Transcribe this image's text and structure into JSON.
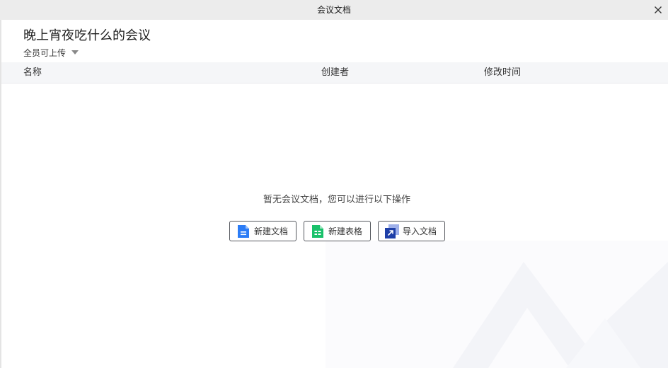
{
  "window": {
    "title": "会议文档",
    "close_icon": "close-icon"
  },
  "meeting": {
    "title": "晚上宵夜吃什么的会议",
    "permission": "全员可上传"
  },
  "table": {
    "columns": {
      "name": "名称",
      "creator": "创建者",
      "modified": "修改时间"
    }
  },
  "empty_state": {
    "message": "暂无会议文档，您可以进行以下操作",
    "actions": {
      "new_doc": {
        "label": "新建文档",
        "icon": "document-icon",
        "color": "#2b7cf6"
      },
      "new_sheet": {
        "label": "新建表格",
        "icon": "spreadsheet-icon",
        "color": "#19c16a"
      },
      "import_doc": {
        "label": "导入文档",
        "icon": "import-arrow-icon",
        "color": "#1e3fa8"
      }
    }
  }
}
